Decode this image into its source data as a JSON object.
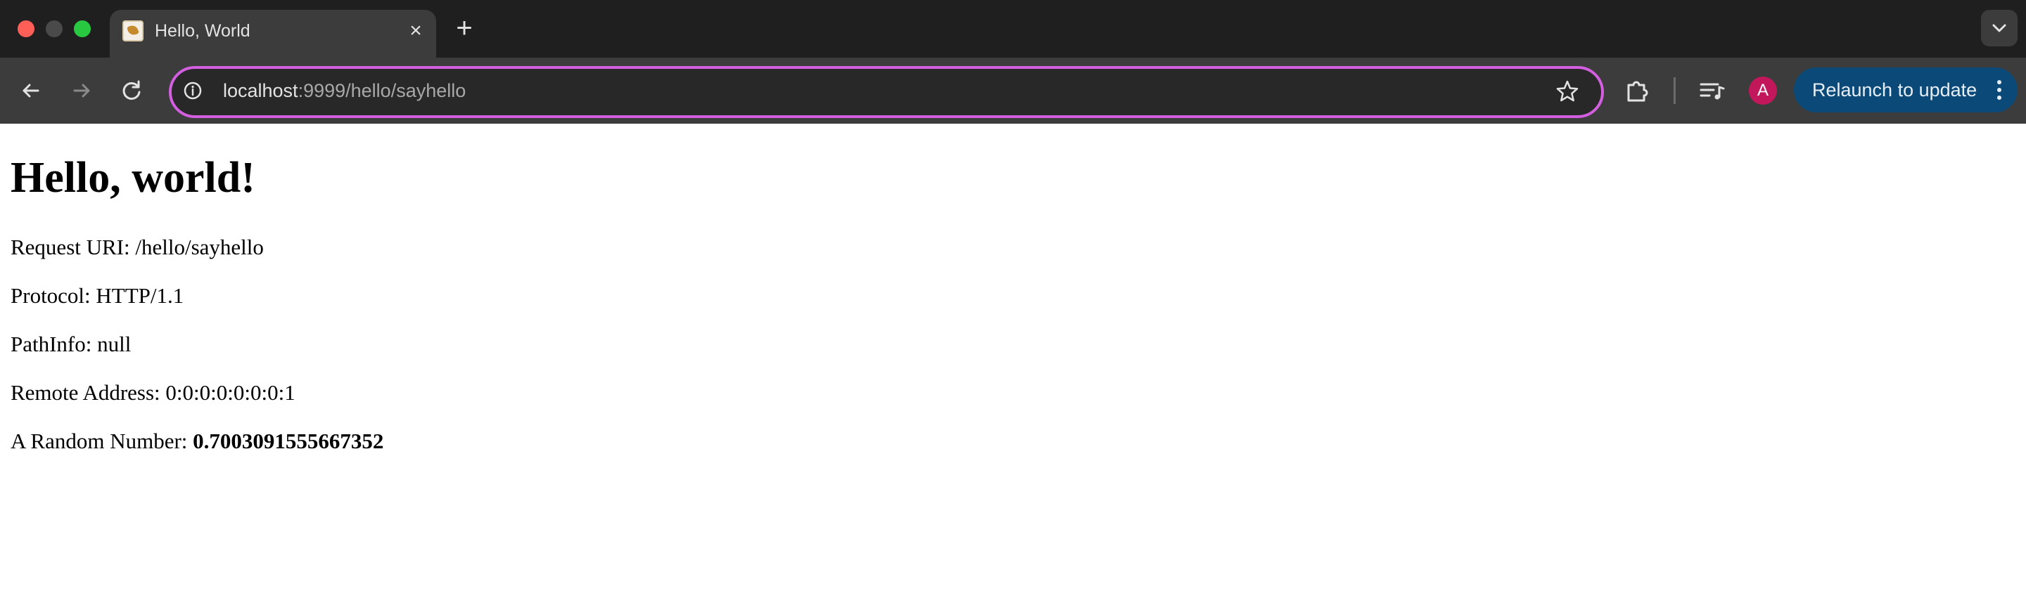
{
  "browser": {
    "tab": {
      "title": "Hello, World"
    },
    "address_bar": {
      "url_host": "localhost",
      "url_rest": ":9999/hello/sayhello"
    },
    "profile_initial": "A",
    "relaunch_label": "Relaunch to update",
    "accent_color": "#d35ee0",
    "icons": [
      "close-icon",
      "plus-icon",
      "chevron-down-icon",
      "back-arrow-icon",
      "forward-arrow-icon",
      "reload-icon",
      "info-icon",
      "star-icon",
      "puzzle-icon",
      "media-control-icon",
      "kebab-menu-icon"
    ]
  },
  "page": {
    "heading": "Hello, world!",
    "lines": [
      {
        "label": "Request URI: ",
        "value": "/hello/sayhello"
      },
      {
        "label": "Protocol: ",
        "value": "HTTP/1.1"
      },
      {
        "label": "PathInfo: ",
        "value": "null"
      },
      {
        "label": "Remote Address: ",
        "value": "0:0:0:0:0:0:0:1"
      }
    ],
    "random": {
      "label": "A Random Number: ",
      "value": "0.7003091555667352"
    }
  }
}
